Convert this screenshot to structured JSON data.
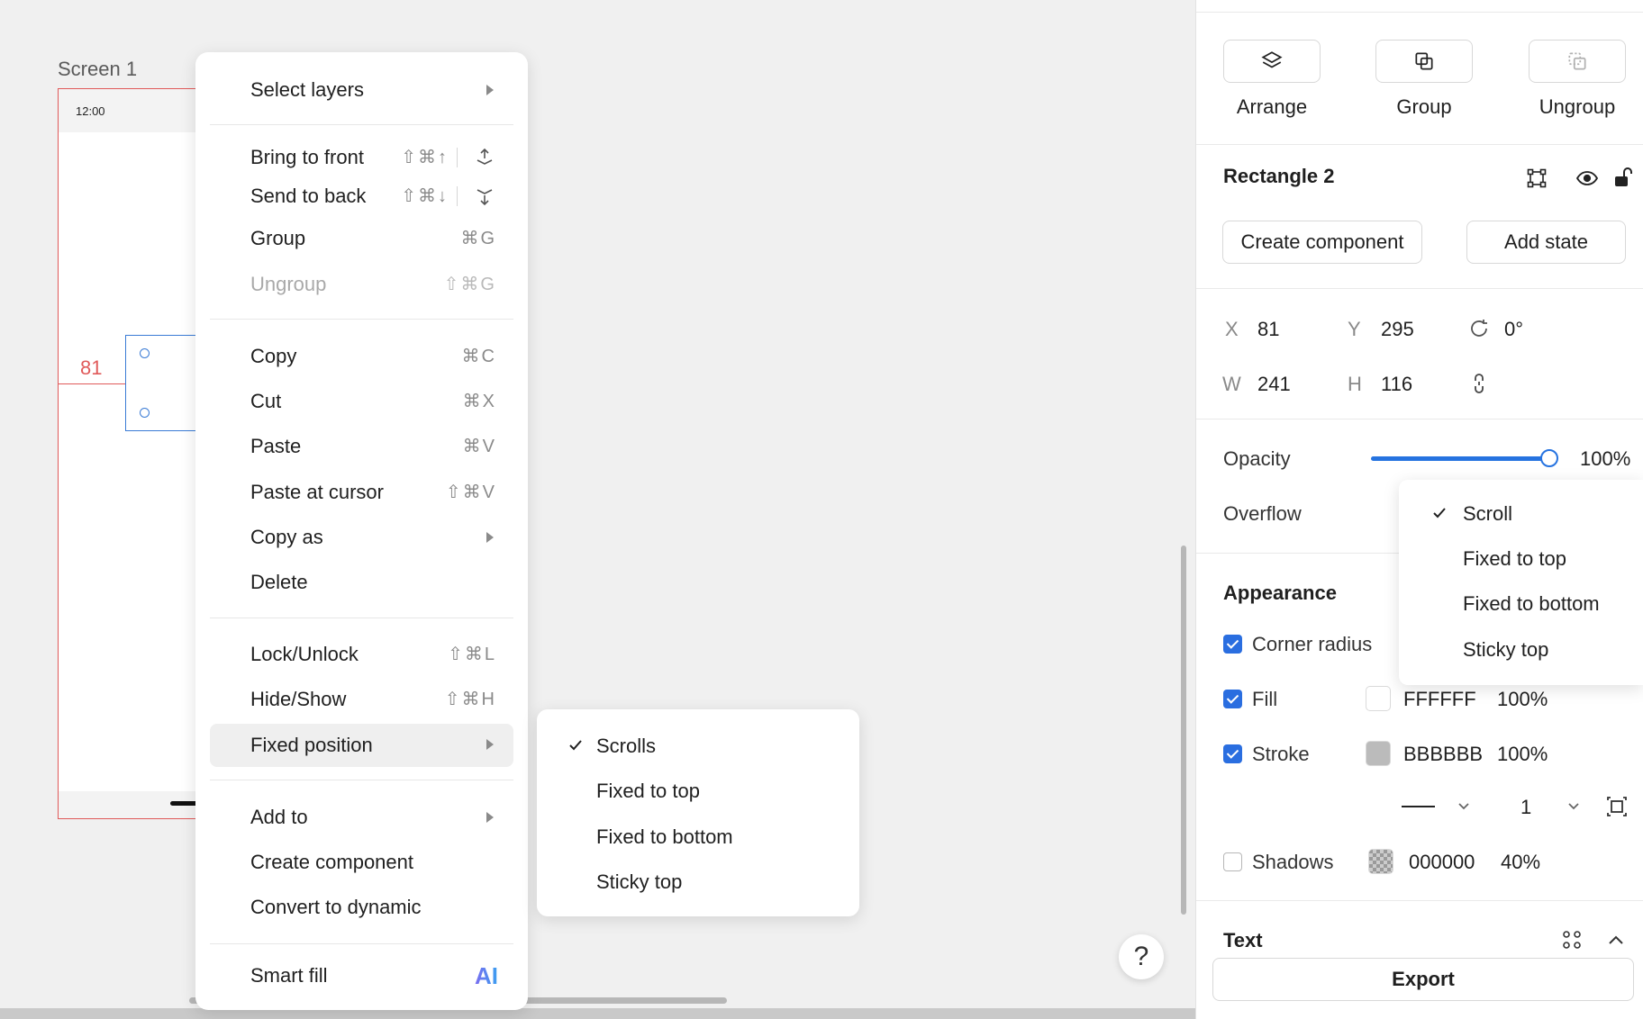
{
  "canvas": {
    "screen_label": "Screen 1",
    "status_time": "12:00",
    "guide_value": "81",
    "help_label": "?"
  },
  "context_menu": {
    "items": [
      {
        "label": "Select layers",
        "shortcut": ""
      },
      {
        "label": "Bring to front",
        "shortcut": "⇧⌘↑"
      },
      {
        "label": "Send to back",
        "shortcut": "⇧⌘↓"
      },
      {
        "label": "Group",
        "shortcut": "⌘G"
      },
      {
        "label": "Ungroup",
        "shortcut": "⇧⌘G"
      },
      {
        "label": "Copy",
        "shortcut": "⌘C"
      },
      {
        "label": "Cut",
        "shortcut": "⌘X"
      },
      {
        "label": "Paste",
        "shortcut": "⌘V"
      },
      {
        "label": "Paste at cursor",
        "shortcut": "⇧⌘V"
      },
      {
        "label": "Copy as",
        "shortcut": ""
      },
      {
        "label": "Delete",
        "shortcut": ""
      },
      {
        "label": "Lock/Unlock",
        "shortcut": "⇧⌘L"
      },
      {
        "label": "Hide/Show",
        "shortcut": "⇧⌘H"
      },
      {
        "label": "Fixed position",
        "shortcut": ""
      },
      {
        "label": "Add to",
        "shortcut": ""
      },
      {
        "label": "Create component",
        "shortcut": ""
      },
      {
        "label": "Convert to dynamic",
        "shortcut": ""
      },
      {
        "label": "Smart fill",
        "shortcut": "AI"
      }
    ]
  },
  "fixed_position_submenu": {
    "items": [
      "Scrolls",
      "Fixed to top",
      "Fixed to bottom",
      "Sticky top"
    ],
    "selected": "Scrolls"
  },
  "panel": {
    "toolbar": {
      "arrange": "Arrange",
      "group": "Group",
      "ungroup": "Ungroup"
    },
    "layer_name": "Rectangle 2",
    "create_component": "Create component",
    "add_state": "Add state",
    "geometry": {
      "x_label": "X",
      "x": "81",
      "y_label": "Y",
      "y": "295",
      "rotation": "0°",
      "w_label": "W",
      "w": "241",
      "h_label": "H",
      "h": "116"
    },
    "opacity_label": "Opacity",
    "opacity_value": "100%",
    "opacity_fraction": 1.0,
    "overflow_label": "Overflow",
    "overflow_options": [
      "Scroll",
      "Fixed to top",
      "Fixed to bottom",
      "Sticky top"
    ],
    "overflow_selected": "Scroll",
    "appearance_title": "Appearance",
    "corner_radius_label": "Corner radius",
    "fill_label": "Fill",
    "fill_hex": "FFFFFF",
    "fill_opacity": "100%",
    "stroke_label": "Stroke",
    "stroke_hex": "BBBBBB",
    "stroke_opacity": "100%",
    "stroke_width": "1",
    "shadows_label": "Shadows",
    "shadows_hex": "000000",
    "shadows_opacity": "40%",
    "text_title": "Text",
    "export_label": "Export"
  },
  "colors": {
    "accent": "#2673e0",
    "guide_red": "#e05a5a",
    "selection_blue": "#3a7bd5"
  }
}
